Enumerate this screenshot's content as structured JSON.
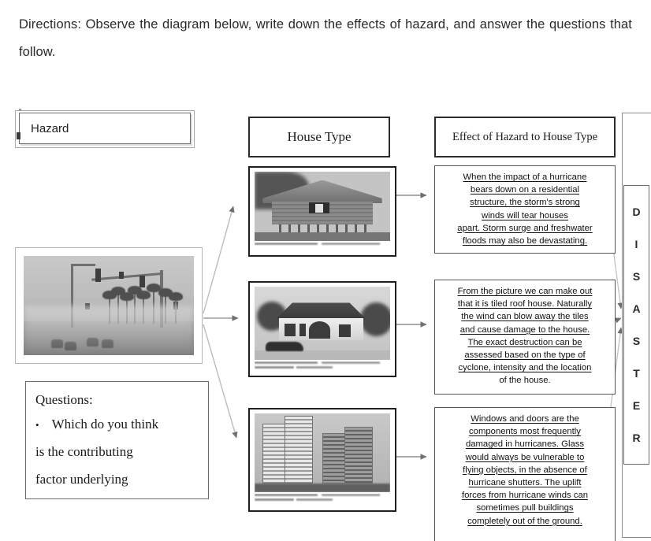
{
  "directions": "Directions: Observe the diagram below, write down the effects of hazard, and answer the questions that follow.",
  "headers": {
    "hazard": "Hazard",
    "house_type": "House Type",
    "effect": "Effect of Hazard to House Type"
  },
  "hazard_image": {
    "alt": "grayscale photo of a typhoon storm on a flooded road with palm trees, traffic lights and motorcycle riders"
  },
  "house_rows": [
    {
      "image_alt": "traditional nipa hut on stilts with thatched roof",
      "caption_illegible": true,
      "effect_lines": [
        {
          "text": "When the impact of a hurricane",
          "underlined": true
        },
        {
          "text": "bears down on a residential",
          "underlined": true
        },
        {
          "text": "structure, the storm's strong",
          "underlined": true
        },
        {
          "text": "winds will tear houses",
          "underlined": true
        },
        {
          "text": "apart. Storm surge and freshwater",
          "underlined": true
        },
        {
          "text": "floods may also be devastating.",
          "underlined": true
        }
      ]
    },
    {
      "image_alt": "single storey bungalow house with tiled roof and a parked car",
      "caption_illegible": true,
      "effect_lines": [
        {
          "text": "From the picture  we can make out",
          "underlined": true
        },
        {
          "text": "that it is tiled  roof house.  Naturally",
          "underlined": true
        },
        {
          "text": "the wind can blow away the tiles",
          "underlined": true
        },
        {
          "text": "and cause damage to the house.",
          "underlined": true
        },
        {
          "text": "The exact destruction  can be",
          "underlined": true
        },
        {
          "text": "assessed based on the type of",
          "underlined": true
        },
        {
          "text": "cyclone,  intensity  and the location",
          "underlined": true
        },
        {
          "text": "of the house.",
          "underlined": false
        }
      ]
    },
    {
      "image_alt": "two high rise condominium towers",
      "caption_illegible": true,
      "effect_lines": [
        {
          "text": "Windows and doors are the",
          "underlined": true
        },
        {
          "text": "components  most frequently",
          "underlined": true
        },
        {
          "text": "damaged in hurricanes. Glass",
          "underlined": true
        },
        {
          "text": "would always be vulnerable to",
          "underlined": true
        },
        {
          "text": "flying objects,  in the absence of",
          "underlined": true
        },
        {
          "text": "hurricane shutters.  The uplift",
          "underlined": true
        },
        {
          "text": "forces from hurricane winds can",
          "underlined": true
        },
        {
          "text": "sometimes pull buildings",
          "underlined": true
        },
        {
          "text": "completely  out  of the ground.",
          "underlined": true
        }
      ]
    }
  ],
  "questions": {
    "title": "Questions:",
    "bullet_glyph": "•",
    "bullet_text": "Which do you think",
    "line2": "is the contributing",
    "line3": "factor underlying"
  },
  "disaster": {
    "letters": [
      "D",
      "I",
      "S",
      "A",
      "S",
      "T",
      "E",
      "R"
    ]
  },
  "colors": {
    "page_background": "#ffffff",
    "text": "#1a1a1a",
    "box_border_dark": "#2b2b2b",
    "box_border_light": "#8d8d8d",
    "connector": "#9a9a9a"
  }
}
